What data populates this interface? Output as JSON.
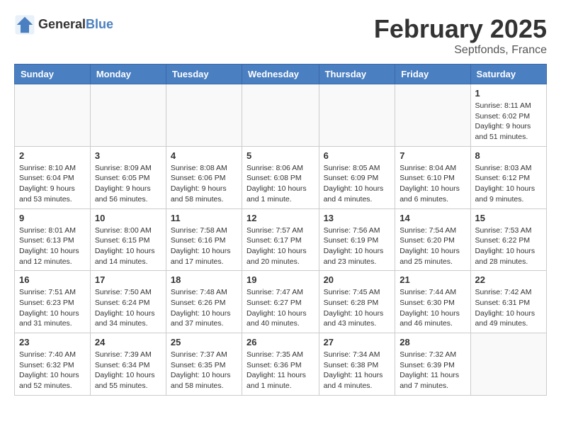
{
  "header": {
    "logo_line1": "General",
    "logo_line2": "Blue",
    "month_title": "February 2025",
    "location": "Septfonds, France"
  },
  "weekdays": [
    "Sunday",
    "Monday",
    "Tuesday",
    "Wednesday",
    "Thursday",
    "Friday",
    "Saturday"
  ],
  "weeks": [
    [
      {
        "day": "",
        "info": ""
      },
      {
        "day": "",
        "info": ""
      },
      {
        "day": "",
        "info": ""
      },
      {
        "day": "",
        "info": ""
      },
      {
        "day": "",
        "info": ""
      },
      {
        "day": "",
        "info": ""
      },
      {
        "day": "1",
        "info": "Sunrise: 8:11 AM\nSunset: 6:02 PM\nDaylight: 9 hours and 51 minutes."
      }
    ],
    [
      {
        "day": "2",
        "info": "Sunrise: 8:10 AM\nSunset: 6:04 PM\nDaylight: 9 hours and 53 minutes."
      },
      {
        "day": "3",
        "info": "Sunrise: 8:09 AM\nSunset: 6:05 PM\nDaylight: 9 hours and 56 minutes."
      },
      {
        "day": "4",
        "info": "Sunrise: 8:08 AM\nSunset: 6:06 PM\nDaylight: 9 hours and 58 minutes."
      },
      {
        "day": "5",
        "info": "Sunrise: 8:06 AM\nSunset: 6:08 PM\nDaylight: 10 hours and 1 minute."
      },
      {
        "day": "6",
        "info": "Sunrise: 8:05 AM\nSunset: 6:09 PM\nDaylight: 10 hours and 4 minutes."
      },
      {
        "day": "7",
        "info": "Sunrise: 8:04 AM\nSunset: 6:10 PM\nDaylight: 10 hours and 6 minutes."
      },
      {
        "day": "8",
        "info": "Sunrise: 8:03 AM\nSunset: 6:12 PM\nDaylight: 10 hours and 9 minutes."
      }
    ],
    [
      {
        "day": "9",
        "info": "Sunrise: 8:01 AM\nSunset: 6:13 PM\nDaylight: 10 hours and 12 minutes."
      },
      {
        "day": "10",
        "info": "Sunrise: 8:00 AM\nSunset: 6:15 PM\nDaylight: 10 hours and 14 minutes."
      },
      {
        "day": "11",
        "info": "Sunrise: 7:58 AM\nSunset: 6:16 PM\nDaylight: 10 hours and 17 minutes."
      },
      {
        "day": "12",
        "info": "Sunrise: 7:57 AM\nSunset: 6:17 PM\nDaylight: 10 hours and 20 minutes."
      },
      {
        "day": "13",
        "info": "Sunrise: 7:56 AM\nSunset: 6:19 PM\nDaylight: 10 hours and 23 minutes."
      },
      {
        "day": "14",
        "info": "Sunrise: 7:54 AM\nSunset: 6:20 PM\nDaylight: 10 hours and 25 minutes."
      },
      {
        "day": "15",
        "info": "Sunrise: 7:53 AM\nSunset: 6:22 PM\nDaylight: 10 hours and 28 minutes."
      }
    ],
    [
      {
        "day": "16",
        "info": "Sunrise: 7:51 AM\nSunset: 6:23 PM\nDaylight: 10 hours and 31 minutes."
      },
      {
        "day": "17",
        "info": "Sunrise: 7:50 AM\nSunset: 6:24 PM\nDaylight: 10 hours and 34 minutes."
      },
      {
        "day": "18",
        "info": "Sunrise: 7:48 AM\nSunset: 6:26 PM\nDaylight: 10 hours and 37 minutes."
      },
      {
        "day": "19",
        "info": "Sunrise: 7:47 AM\nSunset: 6:27 PM\nDaylight: 10 hours and 40 minutes."
      },
      {
        "day": "20",
        "info": "Sunrise: 7:45 AM\nSunset: 6:28 PM\nDaylight: 10 hours and 43 minutes."
      },
      {
        "day": "21",
        "info": "Sunrise: 7:44 AM\nSunset: 6:30 PM\nDaylight: 10 hours and 46 minutes."
      },
      {
        "day": "22",
        "info": "Sunrise: 7:42 AM\nSunset: 6:31 PM\nDaylight: 10 hours and 49 minutes."
      }
    ],
    [
      {
        "day": "23",
        "info": "Sunrise: 7:40 AM\nSunset: 6:32 PM\nDaylight: 10 hours and 52 minutes."
      },
      {
        "day": "24",
        "info": "Sunrise: 7:39 AM\nSunset: 6:34 PM\nDaylight: 10 hours and 55 minutes."
      },
      {
        "day": "25",
        "info": "Sunrise: 7:37 AM\nSunset: 6:35 PM\nDaylight: 10 hours and 58 minutes."
      },
      {
        "day": "26",
        "info": "Sunrise: 7:35 AM\nSunset: 6:36 PM\nDaylight: 11 hours and 1 minute."
      },
      {
        "day": "27",
        "info": "Sunrise: 7:34 AM\nSunset: 6:38 PM\nDaylight: 11 hours and 4 minutes."
      },
      {
        "day": "28",
        "info": "Sunrise: 7:32 AM\nSunset: 6:39 PM\nDaylight: 11 hours and 7 minutes."
      },
      {
        "day": "",
        "info": ""
      }
    ]
  ]
}
